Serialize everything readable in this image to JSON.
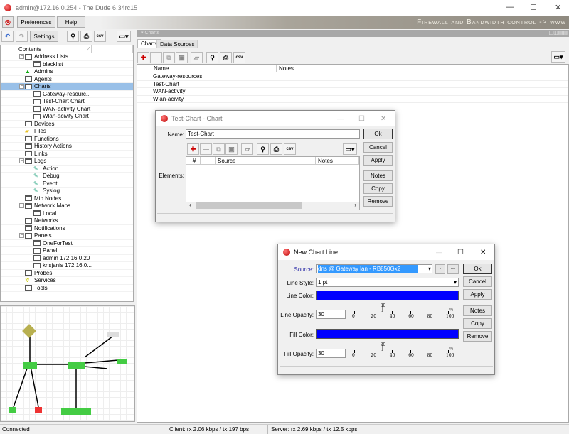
{
  "window": {
    "title": "admin@172.16.0.254 - The Dude 6.34rc15",
    "minimize": "—",
    "maximize": "☐",
    "close": "✕"
  },
  "menu": {
    "preferences": "Preferences",
    "help": "Help"
  },
  "banner": "Firewall and Bandwidth control -> www",
  "toolbar": {
    "settings": "Settings",
    "csv": "csv"
  },
  "tree": {
    "header": "Contents",
    "items": [
      {
        "label": "Address Lists",
        "level": 0,
        "expand": "−",
        "icon": "window"
      },
      {
        "label": "blacklist",
        "level": 1,
        "icon": "window"
      },
      {
        "label": "Admins",
        "level": 0,
        "icon": "admin"
      },
      {
        "label": "Agents",
        "level": 0,
        "icon": "window"
      },
      {
        "label": "Charts",
        "level": 0,
        "expand": "−",
        "icon": "window",
        "selected": true
      },
      {
        "label": "Gateway-resourc...",
        "level": 1,
        "icon": "window"
      },
      {
        "label": "Test-Chart Chart",
        "level": 1,
        "icon": "window"
      },
      {
        "label": "WAN-activity Chart",
        "level": 1,
        "icon": "window"
      },
      {
        "label": "Wlan-acivity Chart",
        "level": 1,
        "icon": "window"
      },
      {
        "label": "Devices",
        "level": 0,
        "icon": "window"
      },
      {
        "label": "Files",
        "level": 0,
        "icon": "folder"
      },
      {
        "label": "Functions",
        "level": 0,
        "icon": "window"
      },
      {
        "label": "History Actions",
        "level": 0,
        "icon": "window"
      },
      {
        "label": "Links",
        "level": 0,
        "icon": "window"
      },
      {
        "label": "Logs",
        "level": 0,
        "expand": "−",
        "icon": "window"
      },
      {
        "label": "Action",
        "level": 1,
        "icon": "log"
      },
      {
        "label": "Debug",
        "level": 1,
        "icon": "log"
      },
      {
        "label": "Event",
        "level": 1,
        "icon": "log"
      },
      {
        "label": "Syslog",
        "level": 1,
        "icon": "log"
      },
      {
        "label": "Mib Nodes",
        "level": 0,
        "icon": "window"
      },
      {
        "label": "Network Maps",
        "level": 0,
        "expand": "−",
        "icon": "window"
      },
      {
        "label": "Local",
        "level": 1,
        "icon": "window"
      },
      {
        "label": "Networks",
        "level": 0,
        "icon": "window"
      },
      {
        "label": "Notifications",
        "level": 0,
        "icon": "window"
      },
      {
        "label": "Panels",
        "level": 0,
        "expand": "−",
        "icon": "window"
      },
      {
        "label": "OneForTest",
        "level": 1,
        "icon": "window"
      },
      {
        "label": "Panel",
        "level": 1,
        "icon": "window"
      },
      {
        "label": "admin 172.16.0.20",
        "level": 1,
        "icon": "window"
      },
      {
        "label": "krisjanis 172.16.0...",
        "level": 1,
        "icon": "window"
      },
      {
        "label": "Probes",
        "level": 0,
        "icon": "window"
      },
      {
        "label": "Services",
        "level": 0,
        "icon": "services"
      },
      {
        "label": "Tools",
        "level": 0,
        "icon": "window"
      }
    ]
  },
  "charts_panel": {
    "title": "Charts",
    "tabs": [
      "Charts",
      "Data Sources"
    ],
    "columns": [
      "Name",
      "Notes"
    ],
    "rows": [
      "Gateway-resources",
      "Test-Chart",
      "WAN-activity",
      "Wlan-acivity"
    ],
    "csv": "csv"
  },
  "chart_dialog": {
    "title": "Test-Chart - Chart",
    "name_label": "Name:",
    "name_value": "Test-Chart",
    "elements_label": "Elements:",
    "columns": [
      "#",
      "Source",
      "Notes"
    ],
    "csv": "csv",
    "buttons": [
      "Ok",
      "Cancel",
      "Apply",
      "Notes",
      "Copy",
      "Remove"
    ]
  },
  "line_dialog": {
    "title": "New Chart Line",
    "source_label": "Source:",
    "source_value": "dns @ Gateway lan - RB850Gx2",
    "line_style_label": "Line Style:",
    "line_style_value": "1 pt",
    "line_color_label": "Line Color:",
    "line_color": "#0000ff",
    "line_opacity_label": "Line Opacity:",
    "line_opacity_value": "30",
    "fill_color_label": "Fill Color:",
    "fill_color": "#0000ff",
    "fill_opacity_label": "Fill Opacity:",
    "fill_opacity_value": "30",
    "slider_value": 30,
    "slider_value_label": "30",
    "slider_ticks": [
      "0",
      "20",
      "40",
      "60",
      "80",
      "100"
    ],
    "percent": "%",
    "small_btn1": "▫",
    "small_btn2": "▫▫▫",
    "buttons": [
      "Ok",
      "Cancel",
      "Apply",
      "Notes",
      "Copy",
      "Remove"
    ]
  },
  "status": {
    "connection": "Connected",
    "client": "Client: rx 2.06 kbps / tx 197 bps",
    "server": "Server: rx 2.69 kbps / tx 12.5 kbps"
  }
}
